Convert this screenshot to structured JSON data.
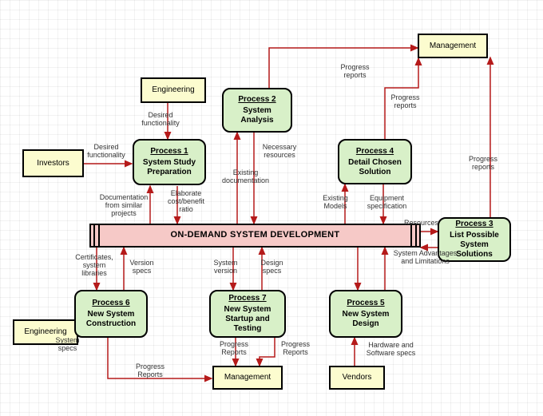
{
  "central": "ON-DEMAND SYSTEM DEVELOPMENT",
  "ext": {
    "investors": "Investors",
    "engineeringTop": "Engineering",
    "engineeringLeft": "Engineering",
    "managementTop": "Management",
    "managementBottom": "Management",
    "vendors": "Vendors"
  },
  "proc": {
    "p1": {
      "t": "Process 1",
      "b": "System Study Preparation"
    },
    "p2": {
      "t": "Process 2",
      "b": "System Analysis"
    },
    "p3": {
      "t": "Process 3",
      "b": "List Possible System Solutions"
    },
    "p4": {
      "t": "Process 4",
      "b": "Detail Chosen Solution"
    },
    "p5": {
      "t": "Process 5",
      "b": "New System Design"
    },
    "p6": {
      "t": "Process 6",
      "b": "New System Construction"
    },
    "p7": {
      "t": "Process 7",
      "b": "New System Startup and Testing"
    }
  },
  "labels": {
    "l1": "Desired functionality",
    "l2": "Desired functionality",
    "l3": "Documentation from similar projects",
    "l4": "Elaborate cost/benefit ratio",
    "l5": "Necessary resources",
    "l6": "Existing documentation",
    "l7": "Progress reports",
    "l8": "Progress reports",
    "l9": "Progress reports",
    "l10": "Existing Models",
    "l11": "Equipment specification",
    "l12": "Resources",
    "l13": "System Advantages and Limitations",
    "l14": "Certificates, system libraries",
    "l15": "Version specs",
    "l16": "System version",
    "l17": "Design specs",
    "l18": "System specs",
    "l19": "Progress Reports",
    "l20": "Progress Reports",
    "l21": "Progress Reports",
    "l22": "Hardware and Software specs"
  }
}
